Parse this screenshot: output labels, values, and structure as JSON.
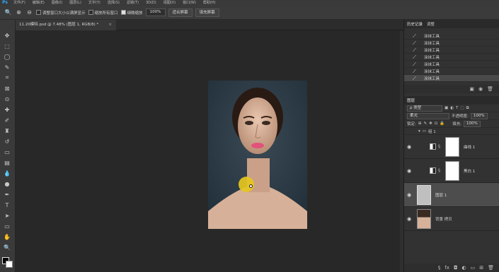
{
  "menubar": {
    "logo": "Ps",
    "items": [
      "文件(F)",
      "编辑(E)",
      "图像(I)",
      "图层(L)",
      "文字(Y)",
      "选择(S)",
      "滤镜(T)",
      "3D(D)",
      "视图(V)",
      "窗口(W)",
      "帮助(H)"
    ]
  },
  "options": {
    "resize_windows": "调整窗口大小以满屏显示",
    "zoom_all": "缩放所有窗口",
    "scrubby_zoom": "细微缩放",
    "zoom_value": "100%",
    "fit_screen": "适合屏幕",
    "fill_screen": "填充屏幕"
  },
  "document": {
    "tab_title": "11.20模特.psd @ 7.48% (图层 1, RGB/8) *",
    "close": "×"
  },
  "history": {
    "tabs": [
      "历史记录",
      "调整"
    ],
    "items": [
      "涂抹工具",
      "涂抹工具",
      "涂抹工具",
      "涂抹工具",
      "涂抹工具",
      "涂抹工具",
      "涂抹工具"
    ]
  },
  "layers": {
    "tab": "图层",
    "filter_kind": "ρ 类型",
    "blend_mode": "柔光",
    "opacity_label": "不透明度:",
    "opacity_value": "100%",
    "lock_label": "锁定:",
    "fill_label": "填充:",
    "fill_value": "100%",
    "group_name": "组 1",
    "items": [
      {
        "name": "曲线 1",
        "type": "adjustment"
      },
      {
        "name": "黑白 1",
        "type": "adjustment"
      },
      {
        "name": "图层 1",
        "type": "pixel"
      },
      {
        "name": "背景 拷贝",
        "type": "photo"
      }
    ]
  },
  "colors": {
    "accent": "#31a8ff",
    "brush_cursor": "#e6c620"
  }
}
